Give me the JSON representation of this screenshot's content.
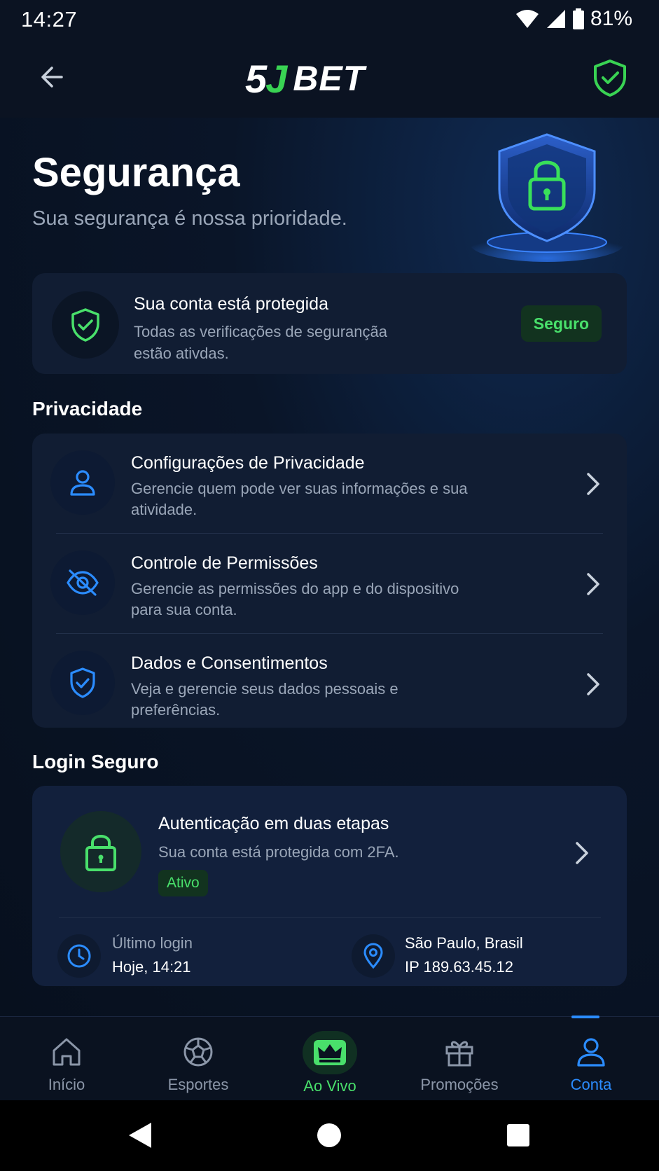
{
  "status": {
    "time": "14:27",
    "battery": "81%"
  },
  "header": {
    "logo_5": "5",
    "logo_j": "J",
    "logo_bet": "BET"
  },
  "hero": {
    "title": "Segurança",
    "subtitle": "Sua segurança é nossa prioridade."
  },
  "protection": {
    "title": "Sua conta está protegida",
    "description": "Todas as verificações de segurançãa estão ativdas.",
    "badge": "Seguro"
  },
  "privacy": {
    "section_title": "Privacidade",
    "items": [
      {
        "title": "Configurações de Privacidade",
        "description": "Gerencie quem pode ver suas informações e sua atividade.",
        "icon": "user-icon"
      },
      {
        "title": "Controle de Permissões",
        "description": "Gerencie as permissões do app e do dispositivo para sua conta.",
        "icon": "eye-off-icon"
      },
      {
        "title": "Dados e Consentimentos",
        "description": "Veja e gerencie seus dados pessoais e preferências.",
        "icon": "shield-check-icon"
      }
    ]
  },
  "login": {
    "section_title": "Login Seguro",
    "title": "Autenticação em duas etapas",
    "description": "Sua conta está protegida com 2FA.",
    "badge": "Ativo",
    "last_login_label": "Último login",
    "last_login_value": "Hoje, 14:21",
    "location_label": "São Paulo, Brasil",
    "location_ip": "IP 189.63.45.12"
  },
  "nav": {
    "items": [
      {
        "label": "Início",
        "icon": "home-icon"
      },
      {
        "label": "Esportes",
        "icon": "soccer-ball-icon"
      },
      {
        "label": "Ao Vivo",
        "icon": "crown-icon"
      },
      {
        "label": "Promoções",
        "icon": "gift-icon"
      },
      {
        "label": "Conta",
        "icon": "user-icon"
      }
    ],
    "active": "Conta"
  },
  "colors": {
    "accent_green": "#49e06b",
    "accent_blue": "#2b8cff",
    "background": "#0a1424",
    "card": "#111d33"
  }
}
